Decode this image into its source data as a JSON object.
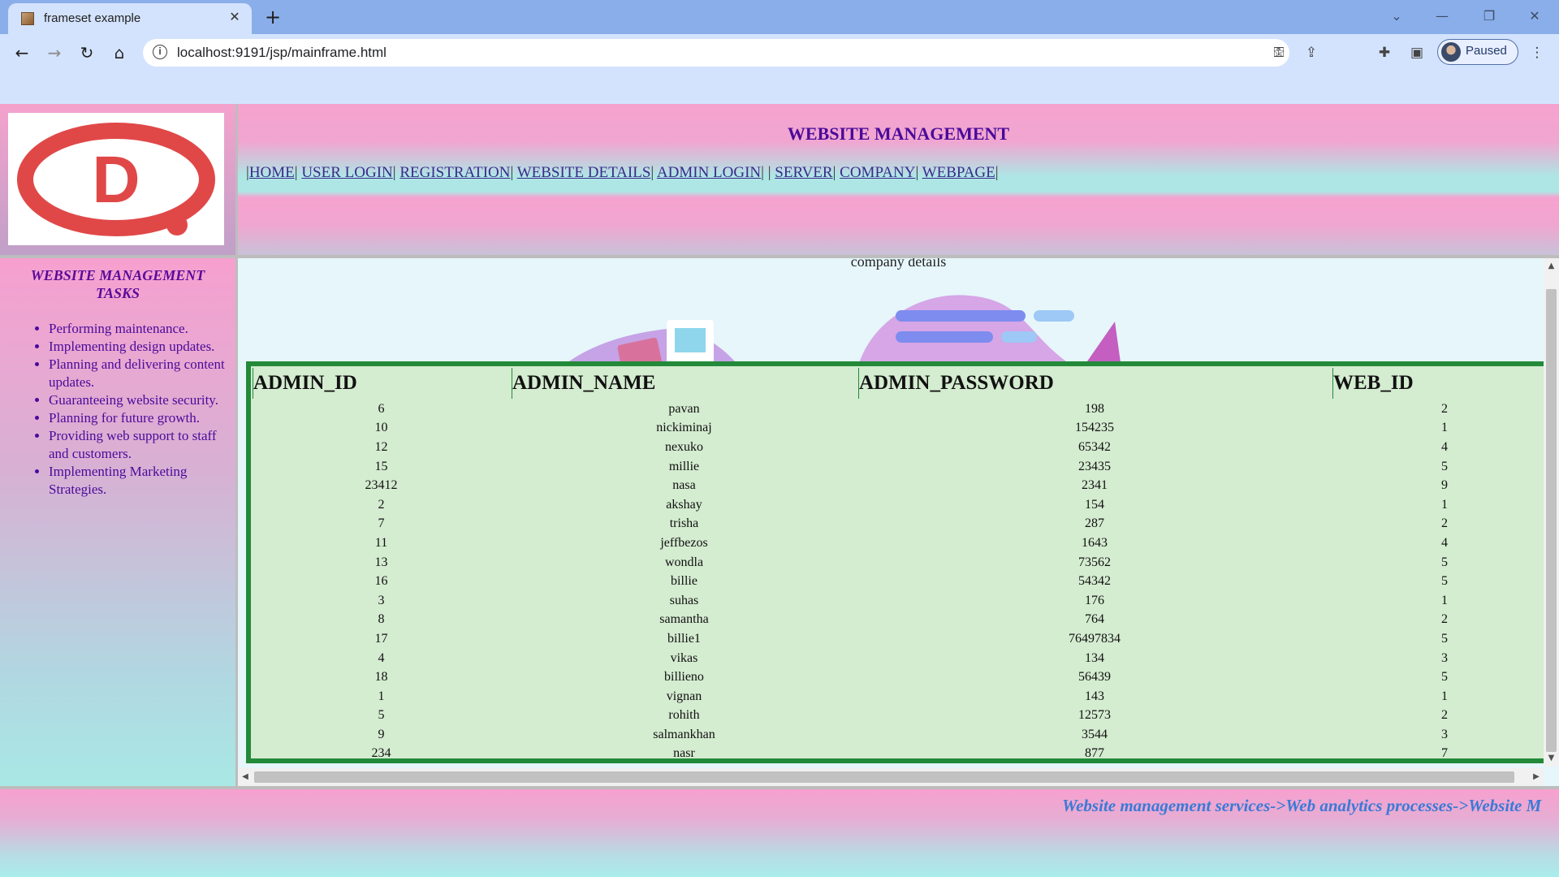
{
  "browser": {
    "tab_title": "frameset example",
    "url": "localhost:9191/jsp/mainframe.html",
    "profile_status": "Paused",
    "icons": [
      "back-icon",
      "forward-icon",
      "reload-icon",
      "home-icon",
      "info-icon",
      "key-icon",
      "share-icon",
      "star-icon",
      "extensions-icon",
      "sidepanel-icon",
      "menu-icon"
    ]
  },
  "header": {
    "title": "WEBSITE MANAGEMENT",
    "nav": [
      "HOME",
      "USER LOGIN",
      "REGISTRATION",
      "WEBSITE DETAILS",
      "ADMIN LOGIN",
      "SERVER",
      "COMPANY",
      "WEBPAGE"
    ]
  },
  "sidebar": {
    "title": "WEBSITE MANAGEMENT TASKS",
    "items": [
      "Performing maintenance.",
      "Implementing design updates.",
      "Planning and delivering content updates.",
      "Guaranteeing website security.",
      "Planning for future growth.",
      "Providing web support to staff and customers.",
      "Implementing Marketing Strategies."
    ]
  },
  "main": {
    "caption": "company details",
    "table": {
      "columns": [
        "ADMIN_ID",
        "ADMIN_NAME",
        "ADMIN_PASSWORD",
        "WEB_ID"
      ],
      "rows": [
        [
          "6",
          "pavan",
          "198",
          "2"
        ],
        [
          "10",
          "nickiminaj",
          "154235",
          "1"
        ],
        [
          "12",
          "nexuko",
          "65342",
          "4"
        ],
        [
          "15",
          "millie",
          "23435",
          "5"
        ],
        [
          "23412",
          "nasa",
          "2341",
          "9"
        ],
        [
          "2",
          "akshay",
          "154",
          "1"
        ],
        [
          "7",
          "trisha",
          "287",
          "2"
        ],
        [
          "11",
          "jeffbezos",
          "1643",
          "4"
        ],
        [
          "13",
          "wondla",
          "73562",
          "5"
        ],
        [
          "16",
          "billie",
          "54342",
          "5"
        ],
        [
          "3",
          "suhas",
          "176",
          "1"
        ],
        [
          "8",
          "samantha",
          "764",
          "2"
        ],
        [
          "17",
          "billie1",
          "76497834",
          "5"
        ],
        [
          "4",
          "vikas",
          "134",
          "3"
        ],
        [
          "18",
          "billieno",
          "56439",
          "5"
        ],
        [
          "1",
          "vignan",
          "143",
          "1"
        ],
        [
          "5",
          "rohith",
          "12573",
          "2"
        ],
        [
          "9",
          "salmankhan",
          "3544",
          "3"
        ],
        [
          "234",
          "nasr",
          "877",
          "7"
        ]
      ]
    }
  },
  "footer": {
    "marquee": "Website management services->Web analytics processes->Website M"
  },
  "colors": {
    "accent_purple": "#4a0a9a",
    "table_border": "#238a3a",
    "table_bg": "#d4ecd0",
    "marquee": "#3a7ad6",
    "logo_red": "#e04848"
  }
}
